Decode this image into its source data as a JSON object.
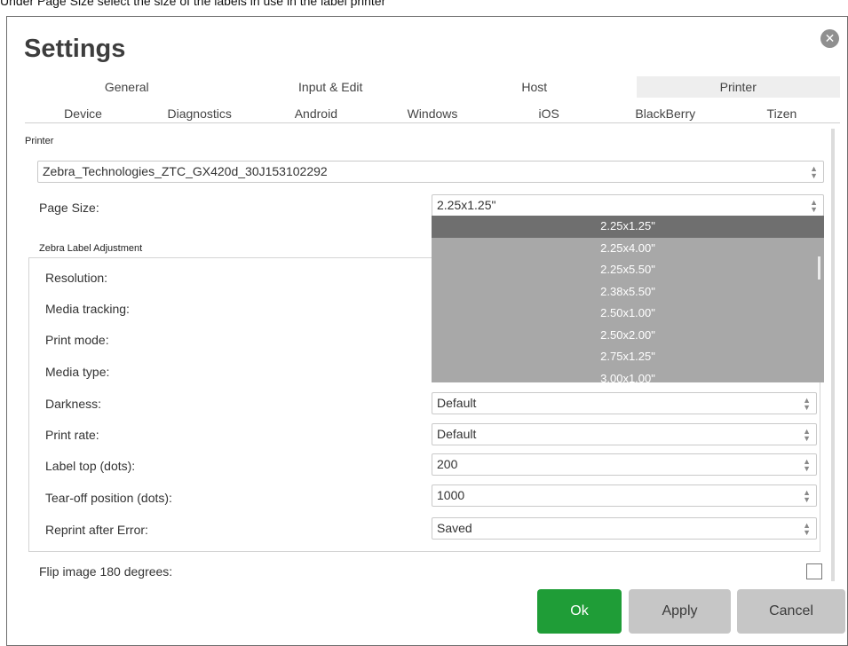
{
  "caption": "Under Page Size select the size of the labels in use in the label printer",
  "dialog": {
    "title": "Settings",
    "close_icon": "close-icon"
  },
  "tabs_primary": [
    {
      "label": "General",
      "active": false
    },
    {
      "label": "Input & Edit",
      "active": false
    },
    {
      "label": "Host",
      "active": false
    },
    {
      "label": "Printer",
      "active": true
    }
  ],
  "tabs_secondary": [
    {
      "label": "Device"
    },
    {
      "label": "Diagnostics"
    },
    {
      "label": "Android"
    },
    {
      "label": "Windows"
    },
    {
      "label": "iOS"
    },
    {
      "label": "BlackBerry"
    },
    {
      "label": "Tizen"
    }
  ],
  "printer_section": {
    "label": "Printer",
    "printer_value": "Zebra_Technologies_ZTC_GX420d_30J153102292",
    "page_size_label": "Page Size:",
    "page_size_value": "2.25x1.25\""
  },
  "zebra_section": {
    "label": "Zebra Label Adjustment",
    "rows": [
      {
        "label": "Resolution:",
        "value": ""
      },
      {
        "label": "Media tracking:",
        "value": ""
      },
      {
        "label": "Print mode:",
        "value": ""
      },
      {
        "label": "Media type:",
        "value": ""
      },
      {
        "label": "Darkness:",
        "value": "Default"
      },
      {
        "label": "Print rate:",
        "value": "Default"
      },
      {
        "label": "Label top (dots):",
        "value": "200"
      },
      {
        "label": "Tear-off position (dots):",
        "value": "1000"
      },
      {
        "label": "Reprint after Error:",
        "value": "Saved"
      }
    ]
  },
  "dropdown_options": [
    "2.25x1.25\"",
    "2.25x4.00\"",
    "2.25x5.50\"",
    "2.38x5.50\"",
    "2.50x1.00\"",
    "2.50x2.00\"",
    "2.75x1.25\"",
    "3.00x1.00\""
  ],
  "flip_label": "Flip image 180 degrees:",
  "buttons": {
    "ok": "Ok",
    "apply": "Apply",
    "cancel": "Cancel"
  },
  "colors": {
    "ok_button": "#1f9d37",
    "secondary_button": "#c6c6c6",
    "dropdown_bg": "#a8a8a8",
    "dropdown_selected": "#6f6f6f"
  }
}
